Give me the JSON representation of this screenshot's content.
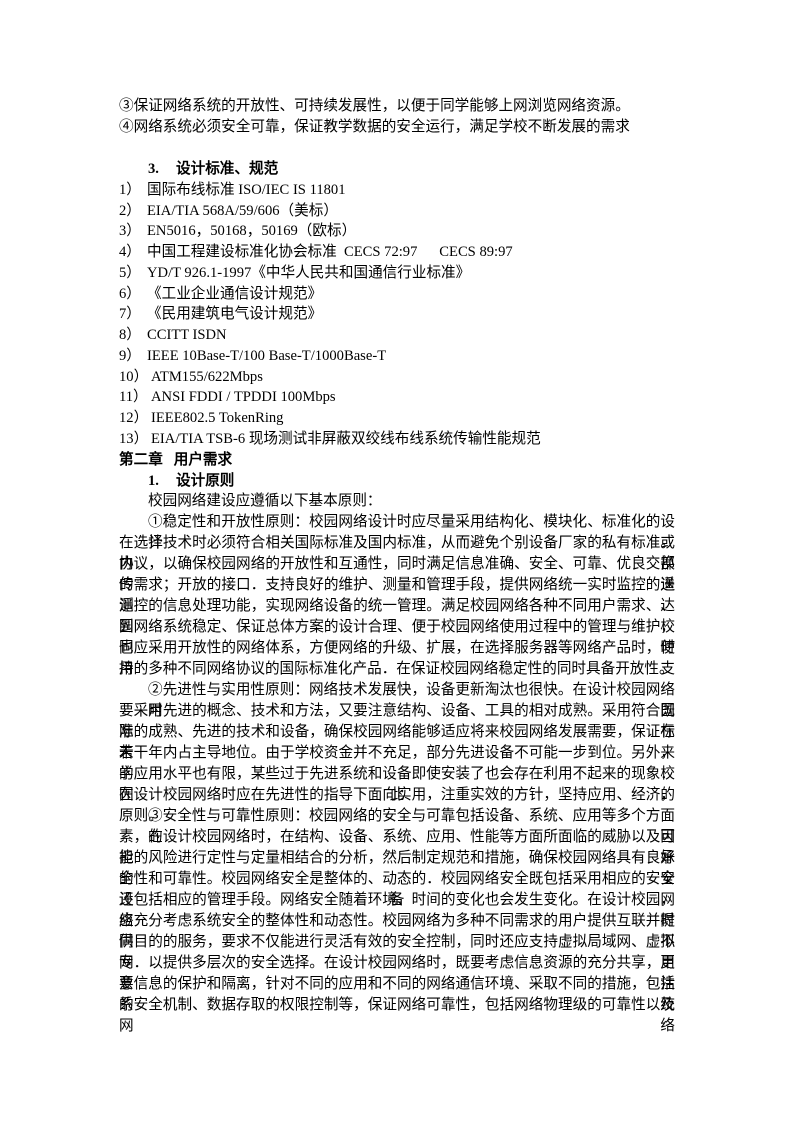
{
  "intro_items": [
    "③保证网络系统的开放性、可持续发展性，以便于同学能够上网浏览网络资源。",
    "④网络系统必须安全可靠，保证教学数据的安全运行，满足学校不断发展的需求"
  ],
  "section3": {
    "number": "3.",
    "title": "设计标准、规范",
    "items": [
      {
        "num": "1）",
        "text": "国际布线标准 ISO/IEC IS 11801"
      },
      {
        "num": "2）",
        "text": "EIA/TIA 568A/59/606（美标）"
      },
      {
        "num": "3）",
        "text": "EN5016，50168，50169（欧标）"
      },
      {
        "num": "4）",
        "text": "中国工程建设标准化协会标准  CECS 72:97      CECS 89:97"
      },
      {
        "num": "5）",
        "text": "YD/T 926.1-1997《中华人民共和国通信行业标准》"
      },
      {
        "num": "6）",
        "text": "《工业企业通信设计规范》"
      },
      {
        "num": "7）",
        "text": "《民用建筑电气设计规范》"
      },
      {
        "num": "8）",
        "text": "CCITT ISDN"
      },
      {
        "num": "9）",
        "text": "IEEE 10Base-T/100 Base-T/1000Base-T"
      },
      {
        "num": "10）",
        "text": "ATM155/622Mbps"
      },
      {
        "num": "11）",
        "text": "ANSI FDDI / TPDDI 100Mbps"
      },
      {
        "num": "12）",
        "text": "IEEE802.5 TokenRing"
      },
      {
        "num": "13）",
        "text": "EIA/TIA TSB-6 现场测试非屏蔽双绞线布线系统传输性能规范"
      }
    ]
  },
  "chapter2": {
    "title": "第二章   用户需求",
    "section1": {
      "number": "1.",
      "title": "设计原则",
      "intro": "校园网络建设应遵循以下基本原则："
    }
  },
  "paragraphs": [
    [
      "①稳定性和开放性原则：校园网络设计时应尽量采用结构化、模块化、标准化的设计。",
      "在选择技术时必须符合相关国际标准及国内标准，从而避免个别设备厂家的私有标准或内部",
      "协议，以确保校园网络的开放性和互通性，同时满足信息准确、安全、可靠、优良交换传送",
      "的需求；开放的接口．支持良好的维护、测量和管理手段，提供网络统一实时监控的遥测、",
      "遥控的信息处理功能，实现网络设备的统一管理。满足校园网络各种不同用户需求、达到校",
      "园网络系统稳定、保证总体方案的设计合理、便于校园网络使用过程中的管理与维护，同时",
      "也应采用开放性的网络体系，方便网络的升级、扩展，在选择服务器等网络产品时，使用支",
      "持的多种不同网络协议的国际标准化产品．在保证校园网络稳定性的同时具备开放性。"
    ],
    [
      "②先进性与实用性原则：网络技术发展快，设备更新淘汰也很快。在设计校园网络时既",
      "要采用先进的概念、技术和方法，又要注意结构、设备、工具的相对成熟。采用符合国际标",
      "准的成熟、先进的技术和设备，确保校园网络能够适应将来校园网络发展需要，保证在未来",
      "若干年内占主导地位。由于学校资金并不充足，部分先进设备不可能一步到位。另外，学校",
      "的应用水平也有限，某些过于先进系统和设备即使安装了也会存在利用不起来的现象．因此，",
      "在设计校园网络时应在先进性的指导下面向实用，注重实效的方针，坚持应用、经济的原则。"
    ],
    [
      "③安全性与可靠性原则：校园网络的安全与可靠包括设备、系统、应用等多个方面的因",
      "素，在设计校园网络时，在结构、设备、系统、应用、性能等方面所面临的威胁以及可能承",
      "担的风险进行定性与定量相结合的分析，然后制定规范和措施，确保校园网络具有良好的安",
      "全性和可靠性。校园网络安全是整体的、动态的．校园网络安全既包括采用相应的安全设备，",
      "还包括相应的管理手段。网络安全随着环境、时间的变化也会发生变化。在设计校园网络时",
      "应充分考虑系统安全的整体性和动态性。校园网络为多种不同需求的用户提供互联并提供不",
      "同目的的服务，要求不仅能进行灵活有效的安全控制，同时还应支持虚拟局域网、虚拟专用",
      "网．以提供多层次的安全选择。在设计校园网络时，既要考虑信息资源的充分共享，更要注",
      "意信息的保护和隔离，针对不同的应用和不同的网络通信环境、采取不同的措施，包括系统",
      "的安全机制、数据存取的权限控制等，保证网络可靠性，包括网络物理级的可靠性以及网络"
    ]
  ]
}
